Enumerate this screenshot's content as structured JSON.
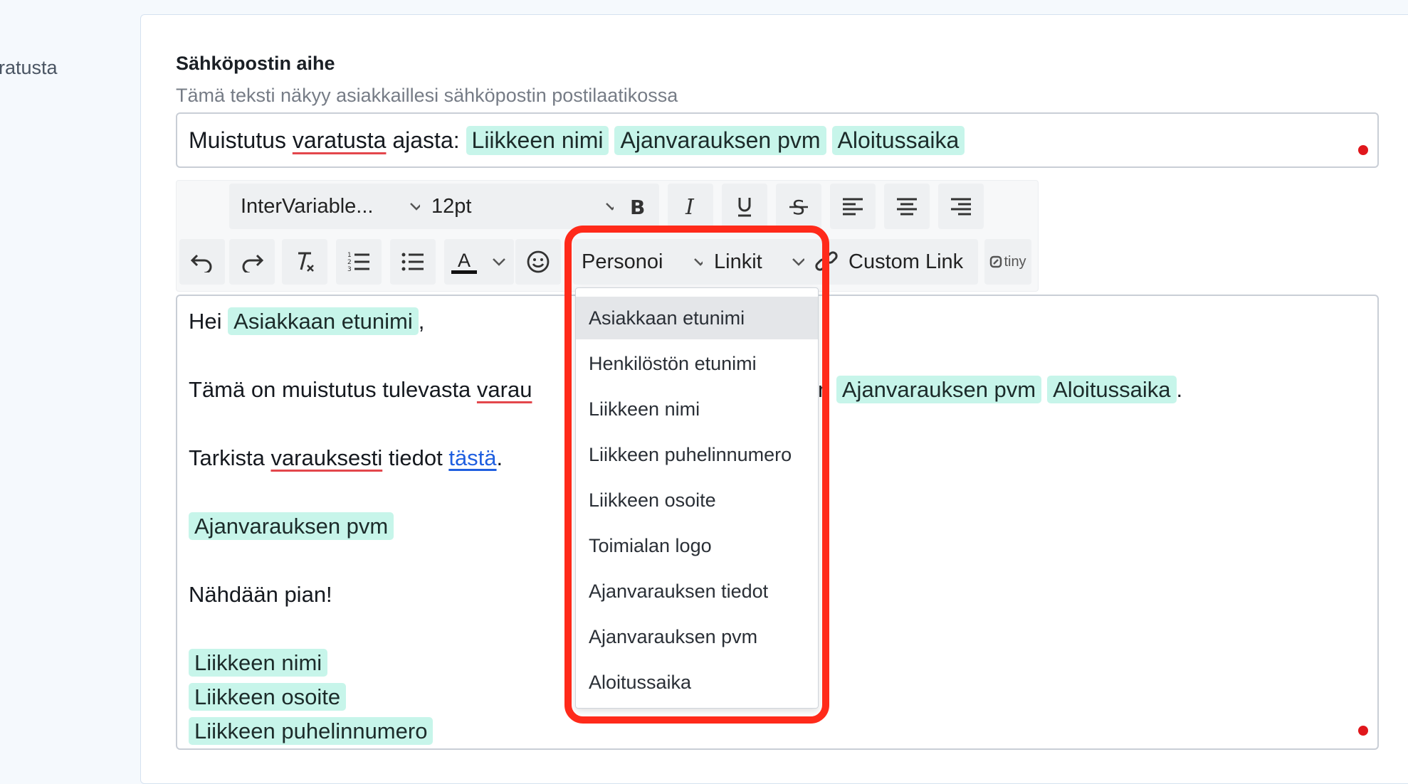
{
  "sidebar": {
    "partial_label": "ratusta"
  },
  "subject": {
    "label": "Sähköpostin aihe",
    "help": "Tämä teksti näkyy asiakkaillesi sähköpostin postilaatikossa",
    "text_prefix": "Muistutus",
    "text_word": "varatusta",
    "text_suffix": "ajasta:",
    "tags": [
      "Liikkeen nimi",
      "Ajanvarauksen pvm",
      "Aloitussaika"
    ]
  },
  "toolbar": {
    "font_family": "InterVariable...",
    "font_size": "12pt",
    "personoi": "Personoi",
    "linkit": "Linkit",
    "custom_link": "Custom Link",
    "tiny": "tiny",
    "text_color_letter": "A"
  },
  "editor": {
    "greeting": "Hei",
    "greeting_tag": "Asiakkaan etunimi",
    "comma": ",",
    "line2_start": "Tämä on muistutus tulevasta",
    "line2_word": "varau",
    "line2_hidden": "n",
    "line2_tags": [
      "Ajanvarauksen pvm",
      "Aloitussaika"
    ],
    "period": ".",
    "line3_start": "Tarkista",
    "line3_word": "varauksesti",
    "line3_mid": "tiedot",
    "line3_link": "tästä",
    "line4_tag": "Ajanvarauksen pvm",
    "line5": "Nähdään pian!",
    "footer_tags": [
      "Liikkeen nimi",
      "Liikkeen osoite",
      "Liikkeen puhelinnumero"
    ]
  },
  "menu": {
    "items": [
      "Asiakkaan etunimi",
      "Henkilöstön etunimi",
      "Liikkeen nimi",
      "Liikkeen puhelinnumero",
      "Liikkeen osoite",
      "Toimialan logo",
      "Ajanvarauksen tiedot",
      "Ajanvarauksen pvm",
      "Aloitussaika"
    ],
    "active_index": 0
  },
  "colors": {
    "tag_bg": "#c7f5ea",
    "highlight": "#ff2a1a",
    "link": "#1f5fe0",
    "required_dot": "#e0171c"
  }
}
